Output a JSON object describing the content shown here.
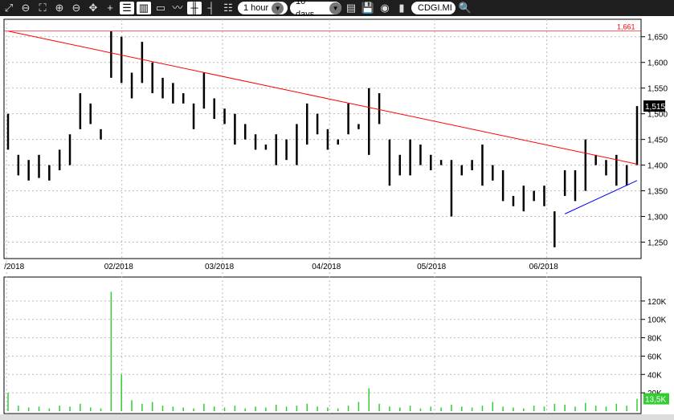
{
  "toolbar": {
    "icons": [
      "zoom-fit-icon",
      "zoom-out-h-icon",
      "zoom-reset-icon",
      "zoom-in-v-icon",
      "zoom-out-v-icon",
      "zoom-all-icon",
      "crosshair-icon",
      "list-icon",
      "columns-icon",
      "window-icon",
      "line-chart-icon",
      "candlestick-icon",
      "ohlc-icon",
      "legend-icon"
    ],
    "interval": "1 hour",
    "period": "10 days",
    "symbol": "CDGI.MI"
  },
  "chart_data": {
    "type": "ohlc",
    "price_axis": {
      "ticks": [
        1250,
        1300,
        1350,
        1400,
        1450,
        1500,
        1550,
        1600,
        1650
      ],
      "labels": [
        "1,250",
        "1,300",
        "1,350",
        "1,400",
        "1,450",
        "1,500",
        "1,550",
        "1,600",
        "1,650"
      ],
      "range": [
        1218,
        1684
      ]
    },
    "date_labels": [
      "/2018",
      "02/2018",
      "03/2018",
      "04/2018",
      "05/2018",
      "06/2018"
    ],
    "date_positions": [
      0.004,
      0.185,
      0.343,
      0.511,
      0.676,
      0.852
    ],
    "last_price": "1,515",
    "high_marker": "1,661",
    "bars": [
      [
        1500,
        1430
      ],
      [
        1420,
        1380
      ],
      [
        1410,
        1370
      ],
      [
        1420,
        1375
      ],
      [
        1400,
        1370
      ],
      [
        1430,
        1390
      ],
      [
        1460,
        1400
      ],
      [
        1540,
        1470
      ],
      [
        1520,
        1480
      ],
      [
        1470,
        1450
      ],
      [
        1661,
        1570
      ],
      [
        1650,
        1560
      ],
      [
        1580,
        1530
      ],
      [
        1640,
        1560
      ],
      [
        1600,
        1540
      ],
      [
        1570,
        1530
      ],
      [
        1560,
        1520
      ],
      [
        1540,
        1520
      ],
      [
        1520,
        1470
      ],
      [
        1580,
        1510
      ],
      [
        1530,
        1490
      ],
      [
        1510,
        1480
      ],
      [
        1500,
        1440
      ],
      [
        1480,
        1450
      ],
      [
        1460,
        1430
      ],
      [
        1440,
        1430
      ],
      [
        1460,
        1400
      ],
      [
        1450,
        1410
      ],
      [
        1480,
        1400
      ],
      [
        1520,
        1440
      ],
      [
        1500,
        1460
      ],
      [
        1470,
        1430
      ],
      [
        1450,
        1440
      ],
      [
        1520,
        1460
      ],
      [
        1480,
        1470
      ],
      [
        1550,
        1420
      ],
      [
        1540,
        1480
      ],
      [
        1450,
        1360
      ],
      [
        1420,
        1380
      ],
      [
        1450,
        1380
      ],
      [
        1440,
        1400
      ],
      [
        1420,
        1390
      ],
      [
        1410,
        1400
      ],
      [
        1410,
        1300
      ],
      [
        1400,
        1380
      ],
      [
        1410,
        1390
      ],
      [
        1440,
        1360
      ],
      [
        1400,
        1370
      ],
      [
        1390,
        1330
      ],
      [
        1340,
        1320
      ],
      [
        1360,
        1310
      ],
      [
        1350,
        1330
      ],
      [
        1360,
        1320
      ],
      [
        1310,
        1240
      ],
      [
        1390,
        1340
      ],
      [
        1390,
        1330
      ],
      [
        1450,
        1350
      ],
      [
        1420,
        1400
      ],
      [
        1410,
        1380
      ],
      [
        1420,
        1360
      ],
      [
        1400,
        1360
      ],
      [
        1515,
        1400
      ]
    ],
    "trendlines": [
      {
        "color": "#ff0000",
        "from": [
          0,
          1661
        ],
        "to": [
          61,
          1402
        ]
      },
      {
        "color": "#0000ff",
        "from": [
          54,
          1305
        ],
        "to": [
          61,
          1370
        ]
      }
    ],
    "volume_axis": {
      "ticks": [
        20,
        40,
        60,
        80,
        100,
        120
      ],
      "labels": [
        "20K",
        "40K",
        "60K",
        "80K",
        "100K",
        "120K"
      ],
      "range": [
        0,
        140
      ]
    },
    "last_volume": "13,5K",
    "volumes": [
      20,
      6,
      4,
      5,
      3,
      6,
      5,
      8,
      4,
      3,
      130,
      40,
      12,
      8,
      10,
      6,
      5,
      4,
      3,
      8,
      5,
      4,
      6,
      3,
      5,
      4,
      7,
      5,
      6,
      8,
      5,
      4,
      3,
      6,
      10,
      25,
      8,
      5,
      4,
      6,
      3,
      5,
      4,
      7,
      5,
      4,
      6,
      10,
      5,
      4,
      3,
      6,
      5,
      8,
      7,
      5,
      9,
      6,
      5,
      8,
      6,
      13.5
    ]
  }
}
